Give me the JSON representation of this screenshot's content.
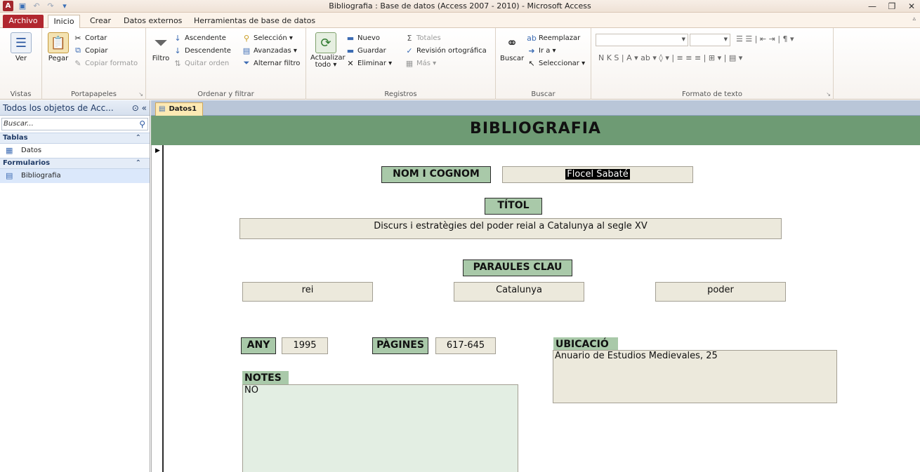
{
  "window": {
    "title": "Bibliografia : Base de datos (Access 2007 - 2010)  -  Microsoft Access",
    "app_icon_letter": "A",
    "minimize": "—",
    "maximize": "❐",
    "close": "✕"
  },
  "tabs": {
    "file": "Archivo",
    "items": [
      "Inicio",
      "Crear",
      "Datos externos",
      "Herramientas de base de datos"
    ]
  },
  "ribbon": {
    "vistas": {
      "view": "Ver",
      "label": "Vistas"
    },
    "portapapeles": {
      "paste": "Pegar",
      "cut": "Cortar",
      "copy": "Copiar",
      "format_painter": "Copiar formato",
      "label": "Portapapeles"
    },
    "ordenar": {
      "filter": "Filtro",
      "asc": "Ascendente",
      "desc": "Descendente",
      "remove_sort": "Quitar orden",
      "selection": "Selección ▾",
      "advanced": "Avanzadas ▾",
      "toggle_filter": "Alternar filtro",
      "label": "Ordenar y filtrar"
    },
    "registros": {
      "refresh_all": "Actualizar\ntodo ▾",
      "new": "Nuevo",
      "save": "Guardar",
      "delete": "Eliminar ▾",
      "totals": "Totales",
      "spelling": "Revisión ortográfica",
      "more": "Más ▾",
      "label": "Registros"
    },
    "buscar": {
      "find": "Buscar",
      "replace": "Reemplazar",
      "goto": "Ir a ▾",
      "select": "Seleccionar ▾",
      "label": "Buscar"
    },
    "formato": {
      "label": "Formato de texto",
      "row2": "N  K  S  |  A ▾  ab ▾  ◊ ▾ |  ≡  ≡  ≡  |  ⊞ ▾  |  ▤ ▾"
    }
  },
  "nav": {
    "header": "Todos los objetos de Acc...",
    "search_placeholder": "Buscar...",
    "sections": [
      {
        "title": "Tablas",
        "items": [
          "Datos"
        ]
      },
      {
        "title": "Formularios",
        "items": [
          "Bibliografia"
        ]
      }
    ]
  },
  "document": {
    "tab": "Datos1",
    "form_title": "BIBLIOGRAFIA",
    "labels": {
      "nom": "NOM I COGNOM",
      "titol": "TÍTOL",
      "paraules": "PARAULES CLAU",
      "any": "ANY",
      "pagines": "PÀGINES",
      "ubicacio": "UBICACIÓ",
      "notes": "NOTES"
    },
    "values": {
      "nom": "Flocel Sabaté",
      "titol": "Discurs i estratègies del poder reial a Catalunya al segle XV",
      "keyword1": "rei",
      "keyword2": "Catalunya",
      "keyword3": "poder",
      "any": "1995",
      "pagines": "617-645",
      "ubicacio": "Anuario de Estudios Medievales, 25",
      "notes": "NO"
    }
  },
  "colors": {
    "file_tab": "#b1272f",
    "form_header": "#6e9b74",
    "label_bg": "#a9c9a9",
    "field_bg": "#ece9dc"
  }
}
